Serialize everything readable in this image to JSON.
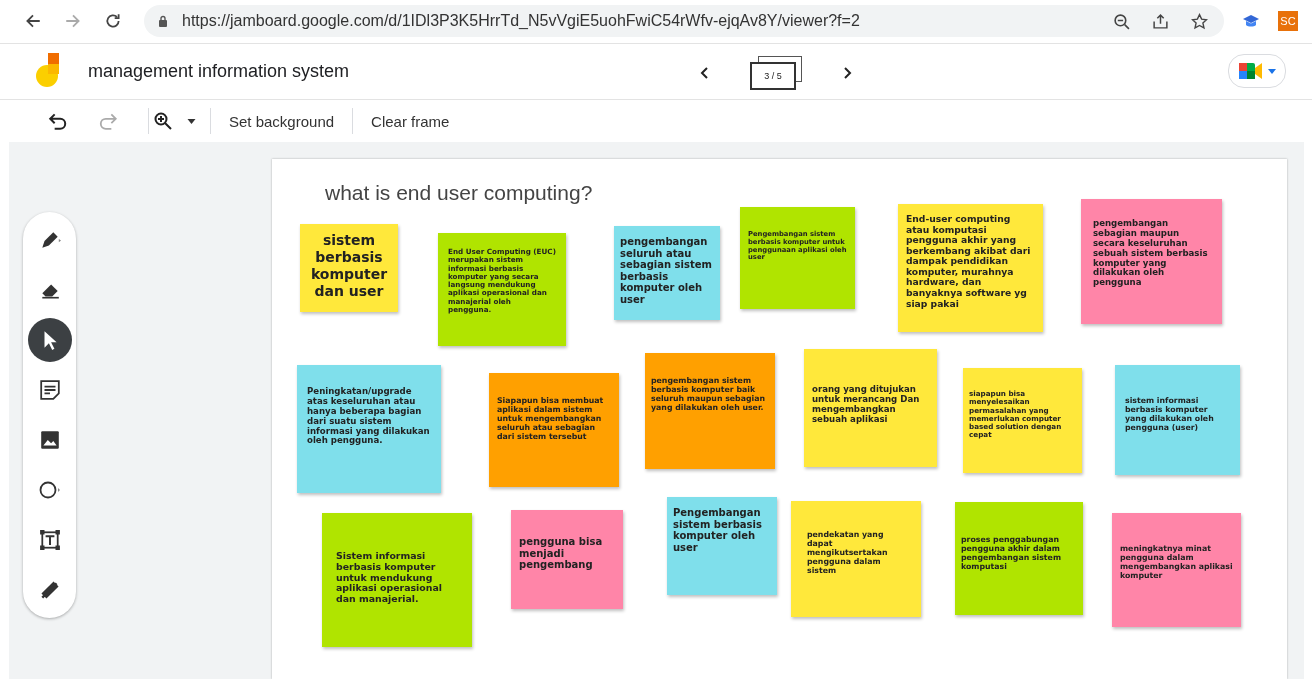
{
  "browser": {
    "url": "https://jamboard.google.com/d/1IDl3P3K5HrrTd_N5vVgiE5uohFwiC54rWfv-ejqAv8Y/viewer?f=2",
    "profile": "SC"
  },
  "app": {
    "title": "management information system",
    "frame_counter": "3 / 5"
  },
  "toolbar": {
    "buttons": [
      "Set background",
      "Clear frame"
    ]
  },
  "tools": [
    {
      "kind": "pen",
      "selected": false
    },
    {
      "kind": "eraser",
      "selected": false
    },
    {
      "kind": "select",
      "selected": true
    },
    {
      "kind": "note",
      "selected": false
    },
    {
      "kind": "image",
      "selected": false
    },
    {
      "kind": "circle",
      "selected": false
    },
    {
      "kind": "textbox",
      "selected": false
    },
    {
      "kind": "laser",
      "selected": false
    }
  ],
  "frame": {
    "title": "what is end user computing?",
    "notes": [
      {
        "text": "sistem berbasis komputer dan user",
        "color": "#ffe83b"
      },
      {
        "text": "End User Computing (EUC) merupakan sistem informasi berbasis komputer yang secara langsung mendukung aplikasi operasional dan manajerial oleh pengguna.",
        "color": "#b0e400"
      },
      {
        "text": "pengembangan seluruh atau sebagian sistem berbasis komputer oleh user",
        "color": "#7fdfeb"
      },
      {
        "text": "Pengembangan sistem berbasis komputer untuk penggunaan aplikasi oleh user",
        "color": "#b0e400"
      },
      {
        "text": "End-user computing atau komputasi pengguna akhir yang berkembang akibat dari dampak pendidikan komputer, murahnya hardware, dan banyaknya software yg siap pakai",
        "color": "#ffe83b"
      },
      {
        "text": "pengembangan sebagian maupun secara keseluruhan sebuah sistem berbasis komputer yang dilakukan oleh pengguna",
        "color": "#ff85a8"
      },
      {
        "text": "Peningkatan/upgrade atas keseluruhan atau hanya beberapa bagian dari suatu sistem informasi yang dilakukan oleh pengguna.",
        "color": "#7fdfeb"
      },
      {
        "text": "Siapapun bisa membuat aplikasi dalam sistem untuk mengembangkan seluruh atau sebagian dari sistem tersebut",
        "color": "#ffa000"
      },
      {
        "text": "pengembangan sistem berbasis komputer baik seluruh maupun sebagian yang dilakukan oleh user.",
        "color": "#ffa000"
      },
      {
        "text": "orang yang ditujukan untuk merancang Dan mengembangkan sebuah aplikasi",
        "color": "#ffe83b"
      },
      {
        "text": "siapapun bisa menyelesaikan permasalahan yang memerlukan computer based solution dengan cepat",
        "color": "#ffe83b"
      },
      {
        "text": "sistem informasi berbasis komputer yang dilakukan oleh pengguna (user)",
        "color": "#7fdfeb"
      },
      {
        "text": "Sistem informasi berbasis komputer untuk mendukung aplikasi operasional dan manajerial.",
        "color": "#b0e400"
      },
      {
        "text": "pengguna bisa menjadi pengembang",
        "color": "#ff85a8"
      },
      {
        "text": "Pengembangan sistem berbasis komputer oleh user",
        "color": "#7fdfeb"
      },
      {
        "text": "pendekatan yang dapat mengikutsertakan pengguna dalam sistem",
        "color": "#ffe83b"
      },
      {
        "text": "proses penggabungan pengguna akhir dalam pengembangan sistem komputasi",
        "color": "#b0e400"
      },
      {
        "text": "meningkatnya minat pengguna dalam mengembangkan aplikasi komputer",
        "color": "#ff85a8"
      }
    ]
  }
}
